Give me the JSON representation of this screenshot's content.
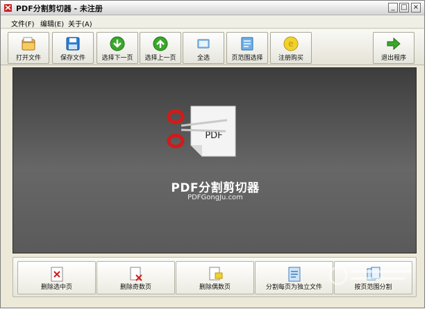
{
  "window": {
    "title": "PDF分割剪切器 - 未注册",
    "controls": {
      "minimize": "_",
      "maximize": "□",
      "close": "×"
    }
  },
  "menu": {
    "items": [
      {
        "label": "文件(F)"
      },
      {
        "label": "编辑(E)"
      },
      {
        "label": "关于(A)"
      }
    ]
  },
  "toolbar": {
    "buttons": [
      {
        "label": "打开文件",
        "icon": "folder-icon"
      },
      {
        "label": "保存文件",
        "icon": "floppy-disk-icon"
      },
      {
        "label": "选择下一页",
        "icon": "arrow-down-circle-icon"
      },
      {
        "label": "选择上一页",
        "icon": "arrow-up-circle-icon"
      },
      {
        "label": "全选",
        "icon": "select-all-icon"
      },
      {
        "label": "页范围选择",
        "icon": "page-range-icon"
      },
      {
        "label": "注册购买",
        "icon": "coin-icon"
      },
      {
        "label": "退出程序",
        "icon": "exit-arrow-icon"
      }
    ]
  },
  "main": {
    "title": "PDF分割剪切器",
    "subtitle": "PDFGongJu.com",
    "logo_text": "PDF"
  },
  "bottom": {
    "buttons": [
      {
        "label": "删除选中页",
        "icon": "delete-page-icon"
      },
      {
        "label": "删除奇数页",
        "icon": "delete-odd-pages-icon"
      },
      {
        "label": "删除偶数页",
        "icon": "delete-even-pages-icon"
      },
      {
        "label": "分割每页为独立文件",
        "icon": "split-pages-icon"
      },
      {
        "label": "按页范围分割",
        "icon": "split-by-range-icon"
      }
    ]
  },
  "colors": {
    "panel_dark": "#3d3d3d",
    "panel_light": "#676767",
    "scissors_red": "#d21a1a",
    "accent_green": "#3aa82b"
  }
}
